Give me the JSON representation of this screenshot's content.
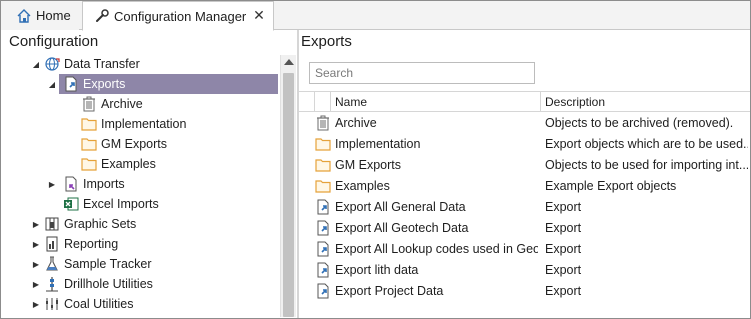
{
  "tabs": [
    {
      "label": "Home",
      "icon": "home-icon"
    },
    {
      "label": "Configuration Manager",
      "icon": "wrench-icon",
      "close_glyph": "✕"
    }
  ],
  "left_pane": {
    "title": "Configuration",
    "tree": [
      {
        "label": "Data Transfer",
        "icon": "globe-arrows-icon",
        "expander": "expanded"
      },
      {
        "label": "Exports",
        "icon": "export-doc-icon",
        "expander": "expanded",
        "selected": true
      },
      {
        "label": "Archive",
        "icon": "trash-icon"
      },
      {
        "label": "Implementation",
        "icon": "folder-icon"
      },
      {
        "label": "GM Exports",
        "icon": "folder-icon"
      },
      {
        "label": "Examples",
        "icon": "folder-icon"
      },
      {
        "label": "Imports",
        "icon": "import-doc-icon",
        "expander": "collapsed"
      },
      {
        "label": "Excel Imports",
        "icon": "excel-icon"
      },
      {
        "label": "Graphic Sets",
        "icon": "graphic-sets-icon",
        "expander": "collapsed"
      },
      {
        "label": "Reporting",
        "icon": "report-icon",
        "expander": "collapsed"
      },
      {
        "label": "Sample Tracker",
        "icon": "flask-icon",
        "expander": "collapsed"
      },
      {
        "label": "Drillhole Utilities",
        "icon": "drillhole-icon",
        "expander": "collapsed"
      },
      {
        "label": "Coal Utilities",
        "icon": "coal-icon",
        "expander": "collapsed"
      }
    ]
  },
  "right_pane": {
    "title": "Exports",
    "search_placeholder": "Search",
    "columns": {
      "name": "Name",
      "description": "Description"
    },
    "rows": [
      {
        "icon": "trash-icon",
        "name": "Archive",
        "description": "Objects to be archived (removed)."
      },
      {
        "icon": "folder-icon",
        "name": "Implementation",
        "description": "Export objects which are to be used..."
      },
      {
        "icon": "folder-icon",
        "name": "GM Exports",
        "description": "Objects to be used for importing int..."
      },
      {
        "icon": "folder-icon",
        "name": "Examples",
        "description": "Example Export objects"
      },
      {
        "icon": "export-doc-icon",
        "name": "Export All General Data",
        "description": "Export"
      },
      {
        "icon": "export-doc-icon",
        "name": "Export All Geotech Data",
        "description": "Export"
      },
      {
        "icon": "export-doc-icon",
        "name": "Export All Lookup codes used in Geo...",
        "description": "Export"
      },
      {
        "icon": "export-doc-icon",
        "name": "Export lith data",
        "description": "Export"
      },
      {
        "icon": "export-doc-icon",
        "name": "Export Project Data",
        "description": "Export"
      }
    ]
  },
  "colors": {
    "selection": "#8e86a8",
    "folder": "#e5a23a",
    "accent_blue": "#2f6fb5"
  }
}
